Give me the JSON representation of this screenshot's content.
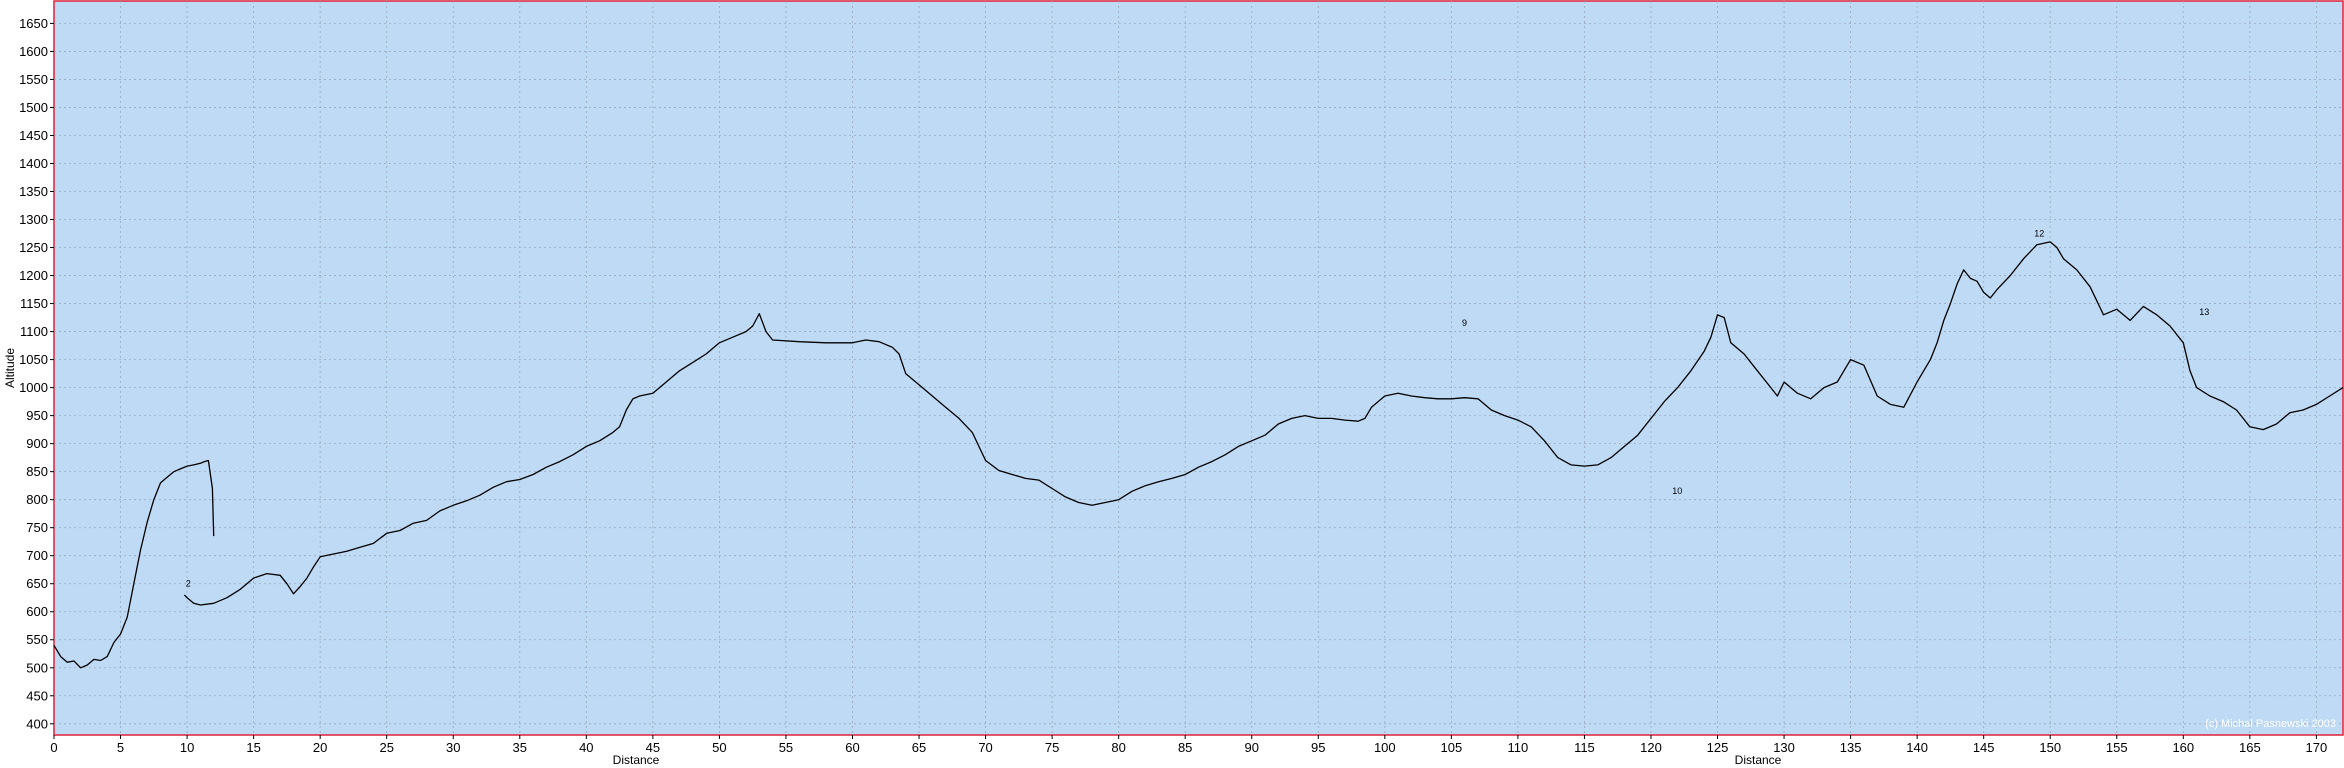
{
  "chart_data": {
    "type": "line",
    "xlabel": "Distance",
    "xlabel_secondary": "Distance",
    "ylabel": "Altitude",
    "xlim": [
      0,
      172
    ],
    "ylim": [
      380,
      1690
    ],
    "x_ticks": [
      0,
      5,
      10,
      15,
      20,
      25,
      30,
      35,
      40,
      45,
      50,
      55,
      60,
      65,
      70,
      75,
      80,
      85,
      90,
      95,
      100,
      105,
      110,
      115,
      120,
      125,
      130,
      135,
      140,
      145,
      150,
      155,
      160,
      165,
      170
    ],
    "y_ticks": [
      400,
      450,
      500,
      550,
      600,
      650,
      700,
      750,
      800,
      850,
      900,
      950,
      1000,
      1050,
      1100,
      1150,
      1200,
      1250,
      1300,
      1350,
      1400,
      1450,
      1500,
      1550,
      1600,
      1650
    ],
    "grid": true,
    "series": [
      {
        "points": [
          [
            0,
            540
          ],
          [
            0.5,
            520
          ],
          [
            1,
            510
          ],
          [
            1.5,
            512
          ],
          [
            2,
            500
          ],
          [
            2.5,
            505
          ],
          [
            3,
            515
          ],
          [
            3.5,
            513
          ],
          [
            4,
            520
          ],
          [
            4.5,
            545
          ],
          [
            5,
            560
          ],
          [
            5.5,
            590
          ],
          [
            6,
            650
          ],
          [
            6.5,
            710
          ],
          [
            7,
            760
          ],
          [
            7.5,
            800
          ],
          [
            8,
            830
          ],
          [
            8.5,
            840
          ],
          [
            9,
            850
          ],
          [
            9.5,
            855
          ],
          [
            10,
            860
          ],
          [
            10.5,
            862
          ],
          [
            11,
            865
          ],
          [
            11.3,
            868
          ],
          [
            11.6,
            870
          ],
          [
            11.9,
            820
          ],
          [
            12,
            735
          ]
        ]
      },
      {
        "points": [
          [
            9.8,
            630
          ],
          [
            10,
            625
          ],
          [
            10.5,
            615
          ],
          [
            11,
            612
          ],
          [
            12,
            615
          ],
          [
            13,
            625
          ],
          [
            14,
            640
          ],
          [
            15,
            660
          ],
          [
            16,
            668
          ],
          [
            17,
            665
          ],
          [
            17.5,
            650
          ],
          [
            18,
            632
          ],
          [
            18.5,
            645
          ],
          [
            19,
            660
          ],
          [
            19.5,
            680
          ],
          [
            20,
            698
          ],
          [
            21,
            703
          ],
          [
            22,
            708
          ],
          [
            23,
            715
          ],
          [
            24,
            722
          ],
          [
            25,
            740
          ],
          [
            26,
            745
          ],
          [
            27,
            758
          ],
          [
            28,
            763
          ],
          [
            29,
            780
          ],
          [
            30,
            790
          ],
          [
            31,
            798
          ],
          [
            32,
            808
          ],
          [
            33,
            822
          ],
          [
            34,
            832
          ],
          [
            35,
            836
          ],
          [
            36,
            845
          ],
          [
            37,
            858
          ],
          [
            38,
            868
          ],
          [
            39,
            880
          ],
          [
            40,
            895
          ],
          [
            41,
            905
          ],
          [
            42,
            920
          ],
          [
            42.5,
            930
          ],
          [
            43,
            960
          ],
          [
            43.5,
            980
          ],
          [
            44,
            985
          ],
          [
            45,
            990
          ],
          [
            46,
            1010
          ],
          [
            47,
            1030
          ],
          [
            48,
            1045
          ],
          [
            49,
            1060
          ],
          [
            50,
            1080
          ],
          [
            51,
            1090
          ],
          [
            52,
            1100
          ],
          [
            52.5,
            1110
          ],
          [
            53,
            1132
          ],
          [
            53.5,
            1100
          ],
          [
            54,
            1085
          ],
          [
            56,
            1082
          ],
          [
            58,
            1080
          ],
          [
            60,
            1080
          ],
          [
            61,
            1085
          ],
          [
            62,
            1082
          ],
          [
            63,
            1072
          ],
          [
            63.5,
            1060
          ],
          [
            64,
            1025
          ],
          [
            65,
            1005
          ],
          [
            66,
            985
          ],
          [
            67,
            965
          ],
          [
            68,
            945
          ],
          [
            69,
            920
          ],
          [
            69.5,
            895
          ],
          [
            70,
            870
          ],
          [
            71,
            852
          ],
          [
            72,
            845
          ],
          [
            73,
            838
          ],
          [
            74,
            835
          ],
          [
            75,
            820
          ],
          [
            76,
            805
          ],
          [
            77,
            795
          ],
          [
            78,
            790
          ],
          [
            79,
            795
          ],
          [
            80,
            800
          ],
          [
            81,
            815
          ],
          [
            82,
            825
          ],
          [
            83,
            832
          ],
          [
            84,
            838
          ],
          [
            85,
            845
          ],
          [
            86,
            858
          ],
          [
            87,
            868
          ],
          [
            88,
            880
          ],
          [
            89,
            895
          ],
          [
            90,
            905
          ],
          [
            91,
            915
          ],
          [
            92,
            935
          ],
          [
            93,
            945
          ],
          [
            94,
            950
          ],
          [
            95,
            945
          ],
          [
            96,
            945
          ],
          [
            97,
            942
          ],
          [
            98,
            940
          ],
          [
            98.5,
            945
          ],
          [
            99,
            965
          ],
          [
            100,
            985
          ],
          [
            101,
            990
          ],
          [
            102,
            985
          ],
          [
            103,
            982
          ],
          [
            104,
            980
          ],
          [
            105,
            980
          ],
          [
            106,
            982
          ],
          [
            107,
            980
          ],
          [
            108,
            960
          ],
          [
            109,
            950
          ],
          [
            110,
            942
          ],
          [
            111,
            930
          ],
          [
            112,
            905
          ],
          [
            113,
            875
          ],
          [
            114,
            862
          ],
          [
            115,
            860
          ],
          [
            116,
            862
          ],
          [
            117,
            875
          ],
          [
            118,
            895
          ],
          [
            119,
            915
          ],
          [
            120,
            945
          ],
          [
            121,
            975
          ],
          [
            122,
            1000
          ],
          [
            123,
            1030
          ],
          [
            124,
            1065
          ],
          [
            124.5,
            1090
          ],
          [
            125,
            1130
          ],
          [
            125.5,
            1125
          ],
          [
            126,
            1080
          ],
          [
            127,
            1060
          ],
          [
            128,
            1030
          ],
          [
            129,
            1000
          ],
          [
            129.5,
            985
          ],
          [
            130,
            1010
          ],
          [
            131,
            990
          ],
          [
            132,
            980
          ],
          [
            133,
            1000
          ],
          [
            134,
            1010
          ],
          [
            135,
            1050
          ],
          [
            136,
            1040
          ],
          [
            137,
            985
          ],
          [
            138,
            970
          ],
          [
            139,
            965
          ],
          [
            140,
            1010
          ],
          [
            141,
            1050
          ],
          [
            141.5,
            1080
          ],
          [
            142,
            1120
          ],
          [
            142.5,
            1150
          ],
          [
            143,
            1185
          ],
          [
            143.5,
            1210
          ],
          [
            144,
            1195
          ],
          [
            144.5,
            1190
          ],
          [
            145,
            1170
          ],
          [
            145.5,
            1160
          ],
          [
            146,
            1175
          ],
          [
            147,
            1200
          ],
          [
            148,
            1230
          ],
          [
            149,
            1255
          ],
          [
            150,
            1260
          ],
          [
            150.5,
            1250
          ],
          [
            151,
            1230
          ],
          [
            152,
            1210
          ],
          [
            153,
            1180
          ],
          [
            154,
            1130
          ],
          [
            155,
            1140
          ],
          [
            156,
            1120
          ],
          [
            157,
            1145
          ],
          [
            158,
            1130
          ],
          [
            159,
            1110
          ],
          [
            160,
            1080
          ],
          [
            160.5,
            1030
          ],
          [
            161,
            1000
          ],
          [
            162,
            985
          ],
          [
            163,
            975
          ],
          [
            164,
            960
          ],
          [
            164.5,
            945
          ],
          [
            165,
            930
          ],
          [
            166,
            925
          ],
          [
            167,
            935
          ],
          [
            168,
            955
          ],
          [
            169,
            960
          ],
          [
            170,
            970
          ],
          [
            171,
            985
          ],
          [
            172,
            1000
          ]
        ]
      }
    ],
    "waypoints": [
      {
        "label": "2",
        "x": 9.9,
        "y": 645
      },
      {
        "label": "9",
        "x": 105.8,
        "y": 1110
      },
      {
        "label": "10",
        "x": 121.6,
        "y": 810
      },
      {
        "label": "12",
        "x": 148.8,
        "y": 1270
      },
      {
        "label": "13",
        "x": 161.2,
        "y": 1130
      }
    ],
    "copyright": "(c) Michal Pasnewski 2003"
  },
  "colors": {
    "plot_background": "#bfdaf5",
    "frame": "#e0203a",
    "grid": "#9aa9bd",
    "line": "#000000"
  }
}
